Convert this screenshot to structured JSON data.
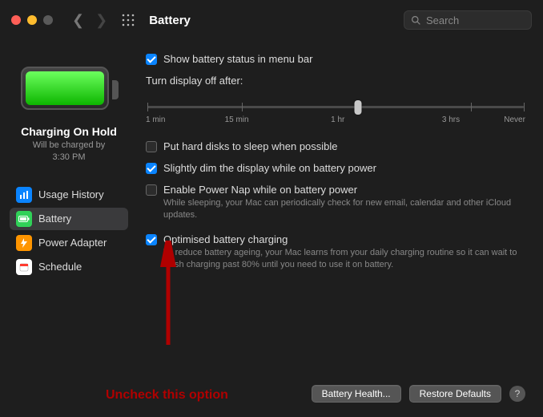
{
  "window": {
    "title": "Battery",
    "search_placeholder": "Search"
  },
  "traffic": {
    "close": "#ff5f57",
    "min": "#febc2e",
    "max": "#5a5a5a"
  },
  "sidebar": {
    "status_title": "Charging On Hold",
    "status_sub1": "Will be charged by",
    "status_sub2": "3:30 PM",
    "items": [
      {
        "label": "Usage History",
        "icon_bg": "#0a84ff",
        "selected": false
      },
      {
        "label": "Battery",
        "icon_bg": "#30d158",
        "selected": true
      },
      {
        "label": "Power Adapter",
        "icon_bg": "#ff9500",
        "selected": false
      },
      {
        "label": "Schedule",
        "icon_bg": "#ffffff",
        "selected": false
      }
    ]
  },
  "settings": {
    "show_status_label": "Show battery status in menu bar",
    "show_status_checked": true,
    "turn_display_label": "Turn display off after:",
    "slider": {
      "ticks": [
        "1 min",
        "15 min",
        "1 hr",
        "3 hrs",
        "Never"
      ],
      "handle_pct": 56
    },
    "hard_disks_label": "Put hard disks to sleep when possible",
    "hard_disks_checked": false,
    "dim_label": "Slightly dim the display while on battery power",
    "dim_checked": true,
    "powernap_label": "Enable Power Nap while on battery power",
    "powernap_checked": false,
    "powernap_desc": "While sleeping, your Mac can periodically check for new email, calendar and other iCloud updates.",
    "optimised_label": "Optimised battery charging",
    "optimised_checked": true,
    "optimised_desc": "To reduce battery ageing, your Mac learns from your daily charging routine so it can wait to finish charging past 80% until you need to use it on battery."
  },
  "buttons": {
    "health": "Battery Health...",
    "restore": "Restore Defaults",
    "help": "?"
  },
  "annotation": {
    "text": "Uncheck this option"
  }
}
